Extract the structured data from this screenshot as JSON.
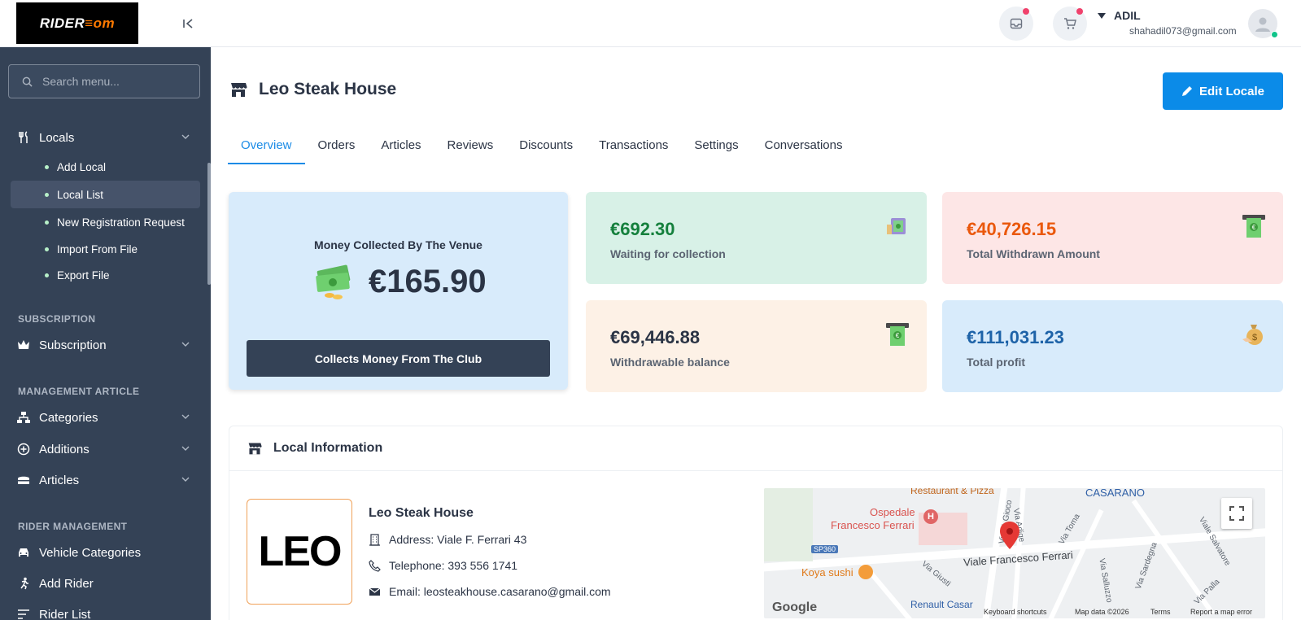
{
  "brand": {
    "logo_text_a": "RIDER",
    "logo_text_b": "om"
  },
  "sidebar": {
    "search_placeholder": "Search menu...",
    "locals": {
      "label": "Locals",
      "children": [
        "Add Local",
        "Local List",
        "New Registration Request",
        "Import From File",
        "Export File"
      ]
    },
    "sections": [
      {
        "title": "SUBSCRIPTION",
        "items": [
          "Subscription"
        ]
      },
      {
        "title": "MANAGEMENT ARTICLE",
        "items": [
          "Categories",
          "Additions",
          "Articles"
        ]
      },
      {
        "title": "RIDER MANAGEMENT",
        "items": [
          "Vehicle Categories",
          "Add Rider",
          "Rider List"
        ]
      }
    ]
  },
  "header": {
    "user_name": "ADIL",
    "user_email": "shahadil073@gmail.com"
  },
  "page": {
    "title": "Leo Steak House",
    "edit_label": "Edit Locale",
    "tabs": [
      "Overview",
      "Orders",
      "Articles",
      "Reviews",
      "Discounts",
      "Transactions",
      "Settings",
      "Conversations"
    ],
    "active_tab": "Overview"
  },
  "cards": {
    "main": {
      "label": "Money Collected By The Venue",
      "amount": "€165.90",
      "button": "Collects Money From The Club"
    },
    "stats": [
      {
        "value": "€692.30",
        "label": "Waiting for collection",
        "color": "#15803d",
        "bg": "#d8f1e7",
        "icon": "cash-hand-icon"
      },
      {
        "value": "€40,726.15",
        "label": "Total Withdrawn Amount",
        "color": "#ea580c",
        "bg": "#fde6e6",
        "icon": "atm-icon"
      },
      {
        "value": "€69,446.88",
        "label": "Withdrawable balance",
        "color": "#2b3445",
        "bg": "#fdf1e6",
        "icon": "atm-icon"
      },
      {
        "value": "€111,031.23",
        "label": "Total profit",
        "color": "#1e63a8",
        "bg": "#d8ebfb",
        "icon": "money-bag-icon"
      }
    ]
  },
  "local_info": {
    "heading": "Local Information",
    "logo_text": "LEO",
    "name": "Leo Steak House",
    "address": "Address: Viale F. Ferrari 43",
    "telephone": "Telephone: 393 556 1741",
    "email": "Email: leosteakhouse.casarano@gmail.com"
  },
  "map": {
    "labels": [
      "Restaurant & Pizza",
      "CASARANO",
      "Ospedale",
      "Francesco Ferrari",
      "SP360",
      "Koya sushi",
      "Viale Francesco Ferrari",
      "Via Giusti",
      "Via Toma",
      "Via Sardegna",
      "Viale Salvatore",
      "Renault Casar",
      "Via Palla",
      "Via Salluzzo",
      "Via V. Gioco",
      "Via Adige"
    ],
    "brand": "Google",
    "footer": [
      "Keyboard shortcuts",
      "Map data ©2026",
      "Terms",
      "Report a map error"
    ]
  }
}
